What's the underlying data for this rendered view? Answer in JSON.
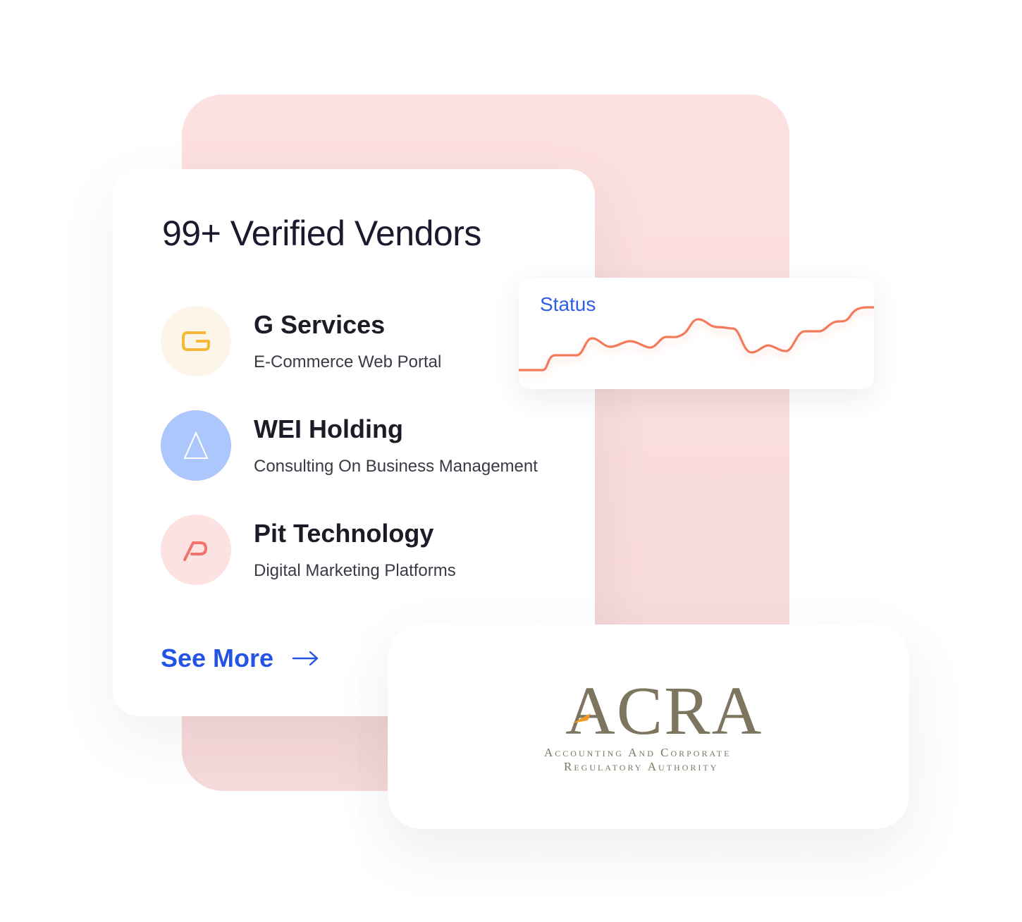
{
  "vendor_card": {
    "title": "99+ Verified Vendors",
    "vendors": [
      {
        "name": "G Services",
        "description": "E-Commerce Web Portal",
        "logo_icon": "g-letter-icon",
        "logo_bg": "#fef5e9",
        "logo_color": "#f5b93a"
      },
      {
        "name": "WEI Holding",
        "description": "Consulting On Business Management",
        "logo_icon": "triangle-icon",
        "logo_bg": "#abc7fb",
        "logo_color": "#ffffff"
      },
      {
        "name": "Pit Technology",
        "description": "Digital Marketing Platforms",
        "logo_icon": "p-letter-icon",
        "logo_bg": "#fde2e2",
        "logo_color": "#f0736d"
      }
    ],
    "see_more_label": "See More",
    "see_more_icon": "arrow-right-icon",
    "accent_color": "#2454e6"
  },
  "status_card": {
    "label": "Status",
    "label_color": "#2f5ee8",
    "line_color": "#f47a5c"
  },
  "acra_card": {
    "logo_word": "ACRA",
    "logo_line1": "Accounting And Corporate",
    "logo_line2": "Regulatory Authority",
    "logo_color": "#7d7560",
    "accent_color": "#f39a22"
  },
  "background": {
    "panel_color": "#fde0e0"
  }
}
